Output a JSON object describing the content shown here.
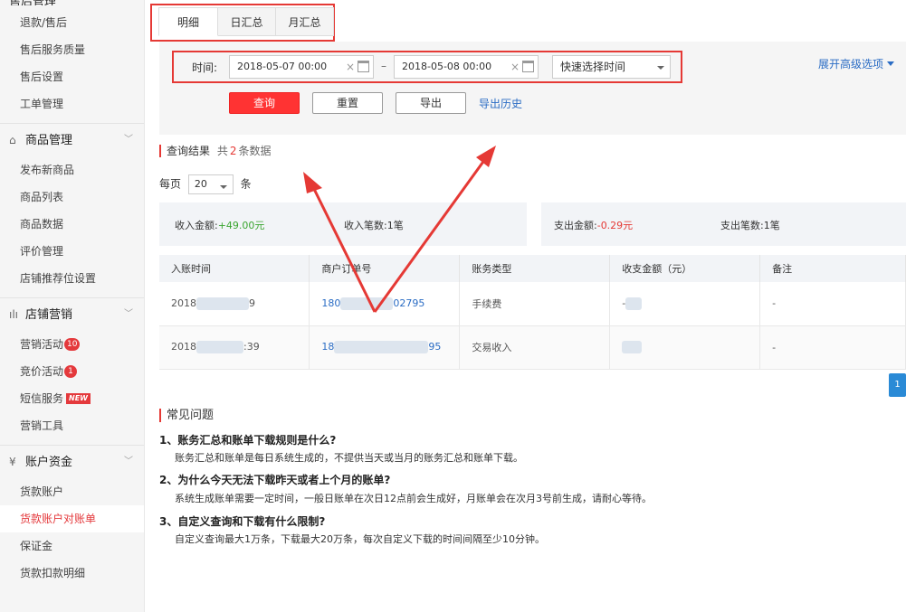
{
  "sidebar": {
    "top_group_label": "售后管理",
    "after_sales": [
      "退款/售后",
      "售后服务质量",
      "售后设置",
      "工单管理"
    ],
    "product_group": {
      "label": "商品管理",
      "items": [
        "发布新商品",
        "商品列表",
        "商品数据",
        "评价管理",
        "店铺推荐位设置"
      ]
    },
    "marketing_group": {
      "label": "店铺营销",
      "items": [
        {
          "label": "营销活动",
          "badge": "10"
        },
        {
          "label": "竞价活动",
          "badge": "1"
        },
        {
          "label": "短信服务",
          "badge": "NEW"
        },
        {
          "label": "营销工具",
          "badge": ""
        }
      ]
    },
    "account_group": {
      "label": "账户资金",
      "items": [
        "货款账户",
        "货款账户对账单",
        "保证金",
        "货款扣款明细"
      ],
      "active_index": 1
    }
  },
  "tabs": [
    {
      "label": "明细",
      "active": true
    },
    {
      "label": "日汇总",
      "active": false
    },
    {
      "label": "月汇总",
      "active": false
    }
  ],
  "filter": {
    "time_label": "时间:",
    "start": "2018-05-07 00:00",
    "end": "2018-05-08 00:00",
    "dash": "–",
    "clear_glyph": "×",
    "quick_select": "快速选择时间",
    "advanced": "展开高级选项"
  },
  "buttons": {
    "query": "查询",
    "reset": "重置",
    "export": "导出",
    "export_history": "导出历史"
  },
  "result": {
    "label": "查询结果",
    "prefix": "共",
    "count": "2",
    "suffix": "条数据",
    "per_page_label": "每页",
    "per_page_value": "20",
    "per_page_unit": "条"
  },
  "summary": {
    "income_amount_label": "收入金额:",
    "income_amount": "+49.00元",
    "income_count_label": "收入笔数:",
    "income_count": "1笔",
    "expense_amount_label": "支出金额:",
    "expense_amount": "-0.29元",
    "expense_count_label": "支出笔数:",
    "expense_count": "1笔"
  },
  "table": {
    "headers": [
      "入账时间",
      "商户订单号",
      "账务类型",
      "收支金额（元）",
      "备注"
    ],
    "rows": [
      {
        "time_start": "2018",
        "time_end": "9",
        "order_start": "180",
        "order_end": "02795",
        "type": "手续费",
        "amount": "-",
        "note": "-"
      },
      {
        "time_start": "2018",
        "time_end": ":39",
        "order_start": "18",
        "order_end": "95",
        "type": "交易收入",
        "amount": "",
        "note": "-"
      }
    ]
  },
  "pagination": {
    "current": "1"
  },
  "faq": {
    "title": "常见问题",
    "items": [
      {
        "q": "1、账务汇总和账单下载规则是什么?",
        "a": "账务汇总和账单是每日系统生成的，不提供当天或当月的账务汇总和账单下载。"
      },
      {
        "q": "2、为什么今天无法下载昨天或者上个月的账单?",
        "a": "系统生成账单需要一定时间，一般日账单在次日12点前会生成好，月账单会在次月3号前生成，请耐心等待。"
      },
      {
        "q": "3、自定义查询和下载有什么限制?",
        "a": "自定义查询最大1万条，下载最大20万条，每次自定义下载的时间间隔至少10分钟。"
      }
    ]
  },
  "colors": {
    "accent_red": "#e53935",
    "link_blue": "#2a6cc4",
    "income_green": "#3aa530"
  }
}
